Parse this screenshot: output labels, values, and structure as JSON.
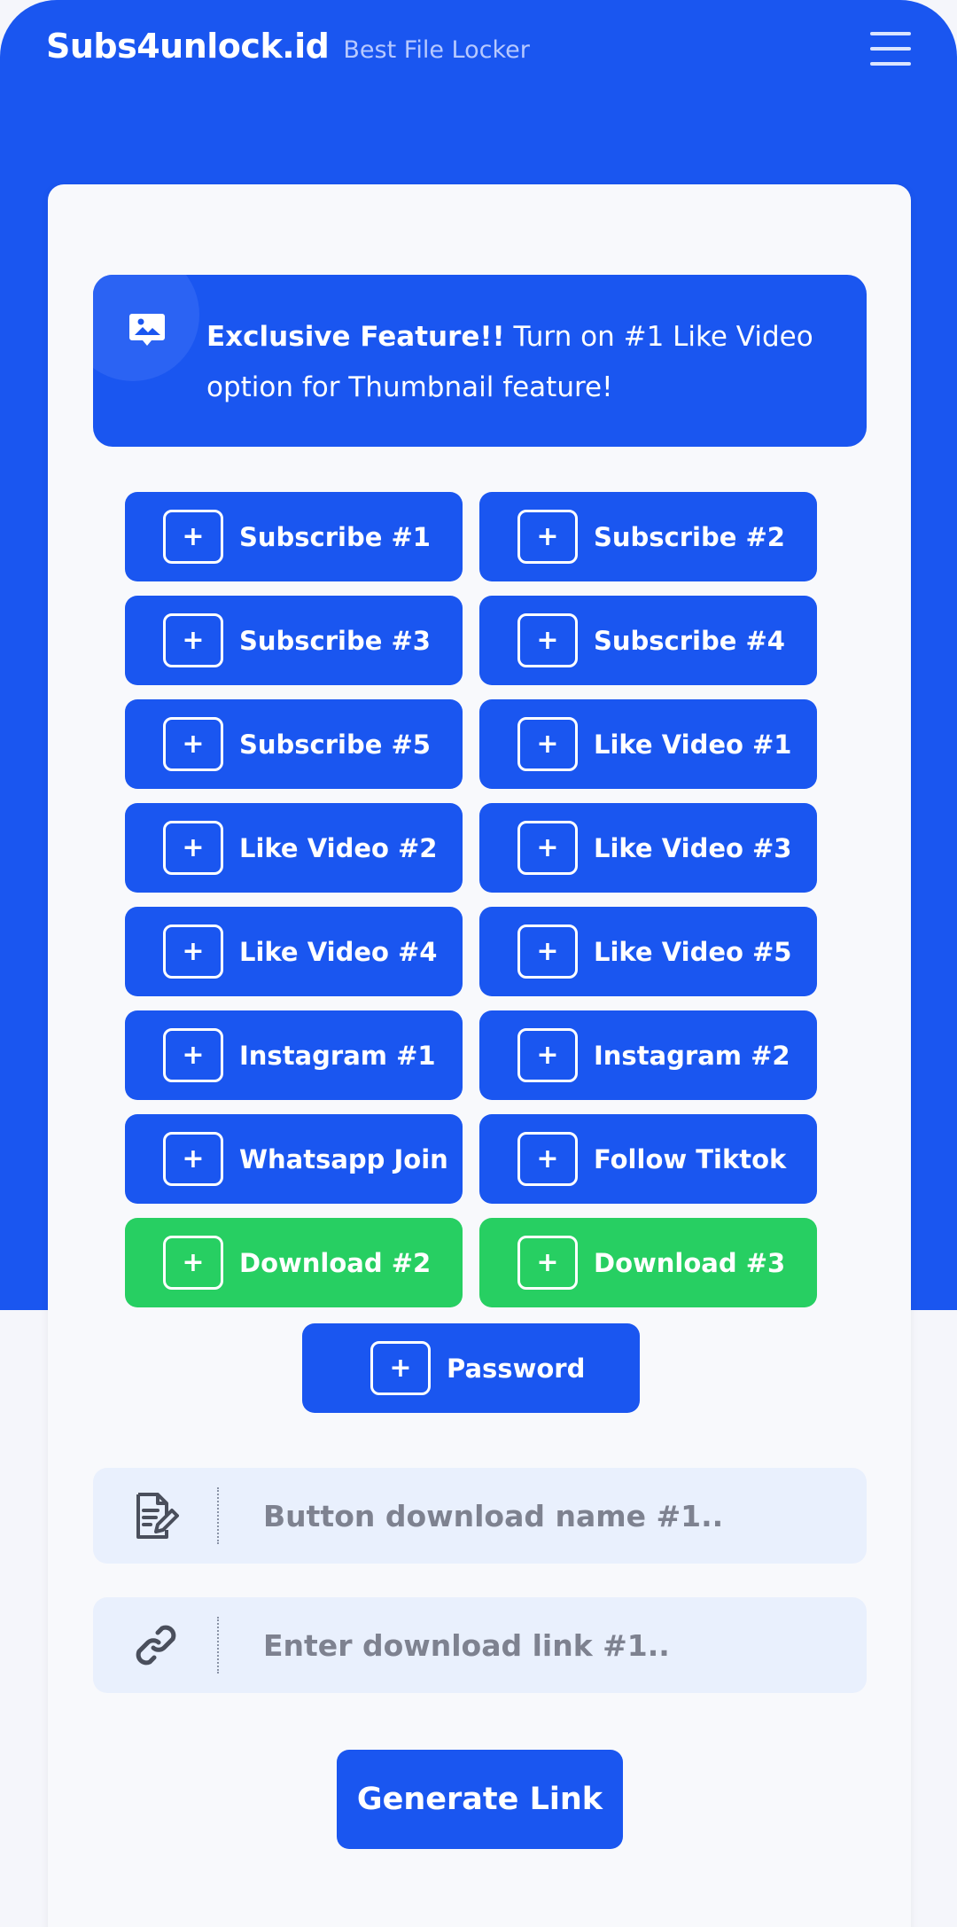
{
  "header": {
    "brand": "Subs4unlock.id",
    "tagline": "Best File Locker",
    "menu_icon": "hamburger-menu-icon"
  },
  "feature": {
    "icon": "image-icon",
    "bold": "Exclusive Feature!!",
    "text": "Turn on #1 Like Video option for Thumbnail feature!"
  },
  "colors": {
    "primary": "#1a56f0",
    "success": "#27cf62",
    "field_bg": "#e9f0fd"
  },
  "buttons": [
    {
      "label": "Subscribe #1",
      "color": "blue"
    },
    {
      "label": "Subscribe #2",
      "color": "blue"
    },
    {
      "label": "Subscribe #3",
      "color": "blue"
    },
    {
      "label": "Subscribe #4",
      "color": "blue"
    },
    {
      "label": "Subscribe #5",
      "color": "blue"
    },
    {
      "label": "Like Video #1",
      "color": "blue"
    },
    {
      "label": "Like Video #2",
      "color": "blue"
    },
    {
      "label": "Like Video #3",
      "color": "blue"
    },
    {
      "label": "Like Video #4",
      "color": "blue"
    },
    {
      "label": "Like Video #5",
      "color": "blue"
    },
    {
      "label": "Instagram #1",
      "color": "blue"
    },
    {
      "label": "Instagram #2",
      "color": "blue"
    },
    {
      "label": "Whatsapp Join",
      "color": "blue"
    },
    {
      "label": "Follow Tiktok",
      "color": "blue"
    },
    {
      "label": "Download #2",
      "color": "green"
    },
    {
      "label": "Download #3",
      "color": "green"
    },
    {
      "label": "Password",
      "color": "blue"
    }
  ],
  "plus_symbol": "+",
  "form": {
    "name_placeholder": "Button download name #1..",
    "name_icon": "edit-document-icon",
    "link_placeholder": "Enter download link #1..",
    "link_icon": "link-icon",
    "generate_label": "Generate Link"
  }
}
